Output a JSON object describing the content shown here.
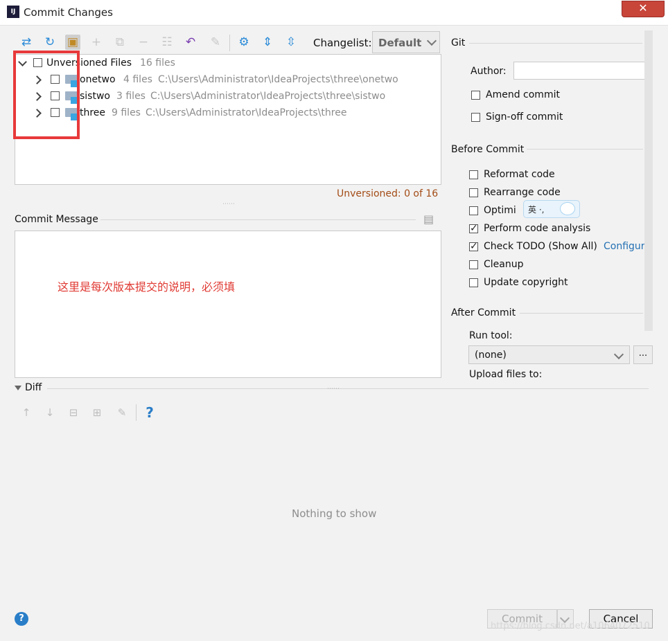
{
  "window": {
    "title": "Commit Changes",
    "app_icon_text": "IJ",
    "close_glyph": "✕"
  },
  "toolbar": {
    "changelist_label": "Changelist:",
    "changelist_value": "Default",
    "help_glyph": "?"
  },
  "tree": {
    "root": {
      "label": "Unversioned Files",
      "count": "16 files"
    },
    "items": [
      {
        "name": "onetwo",
        "count": "4 files",
        "path": "C:\\Users\\Administrator\\IdeaProjects\\three\\onetwo"
      },
      {
        "name": "sistwo",
        "count": "3 files",
        "path": "C:\\Users\\Administrator\\IdeaProjects\\three\\sistwo"
      },
      {
        "name": "three",
        "count": "9 files",
        "path": "C:\\Users\\Administrator\\IdeaProjects\\three"
      }
    ],
    "status": "Unversioned: 0 of 16"
  },
  "commit_message": {
    "label": "Commit Message",
    "annotation": "这里是每次版本提交的说明，必须填"
  },
  "git": {
    "section": "Git",
    "author_label": "Author:",
    "author_value": "",
    "amend": "Amend commit",
    "signoff": "Sign-off commit"
  },
  "before_commit": {
    "section": "Before Commit",
    "reformat": "Reformat code",
    "rearrange": "Rearrange code",
    "optimize": "Optimi",
    "analysis": "Perform code analysis",
    "todo": "Check TODO (Show All)",
    "configure": "Configure",
    "cleanup": "Cleanup",
    "copyright": "Update copyright",
    "check_glyph": "✓"
  },
  "after_commit": {
    "section": "After Commit",
    "run_tool_label": "Run tool:",
    "run_tool_value": "(none)",
    "dots": "...",
    "upload_label": "Upload files to:"
  },
  "ime": {
    "text": "英 ·,"
  },
  "diff": {
    "label": "Diff",
    "empty": "Nothing to show",
    "help_glyph": "?"
  },
  "buttons": {
    "commit": "Commit",
    "cancel": "Cancel",
    "help": "?"
  },
  "watermark": "https://blog.csdn.net/a1064072510"
}
